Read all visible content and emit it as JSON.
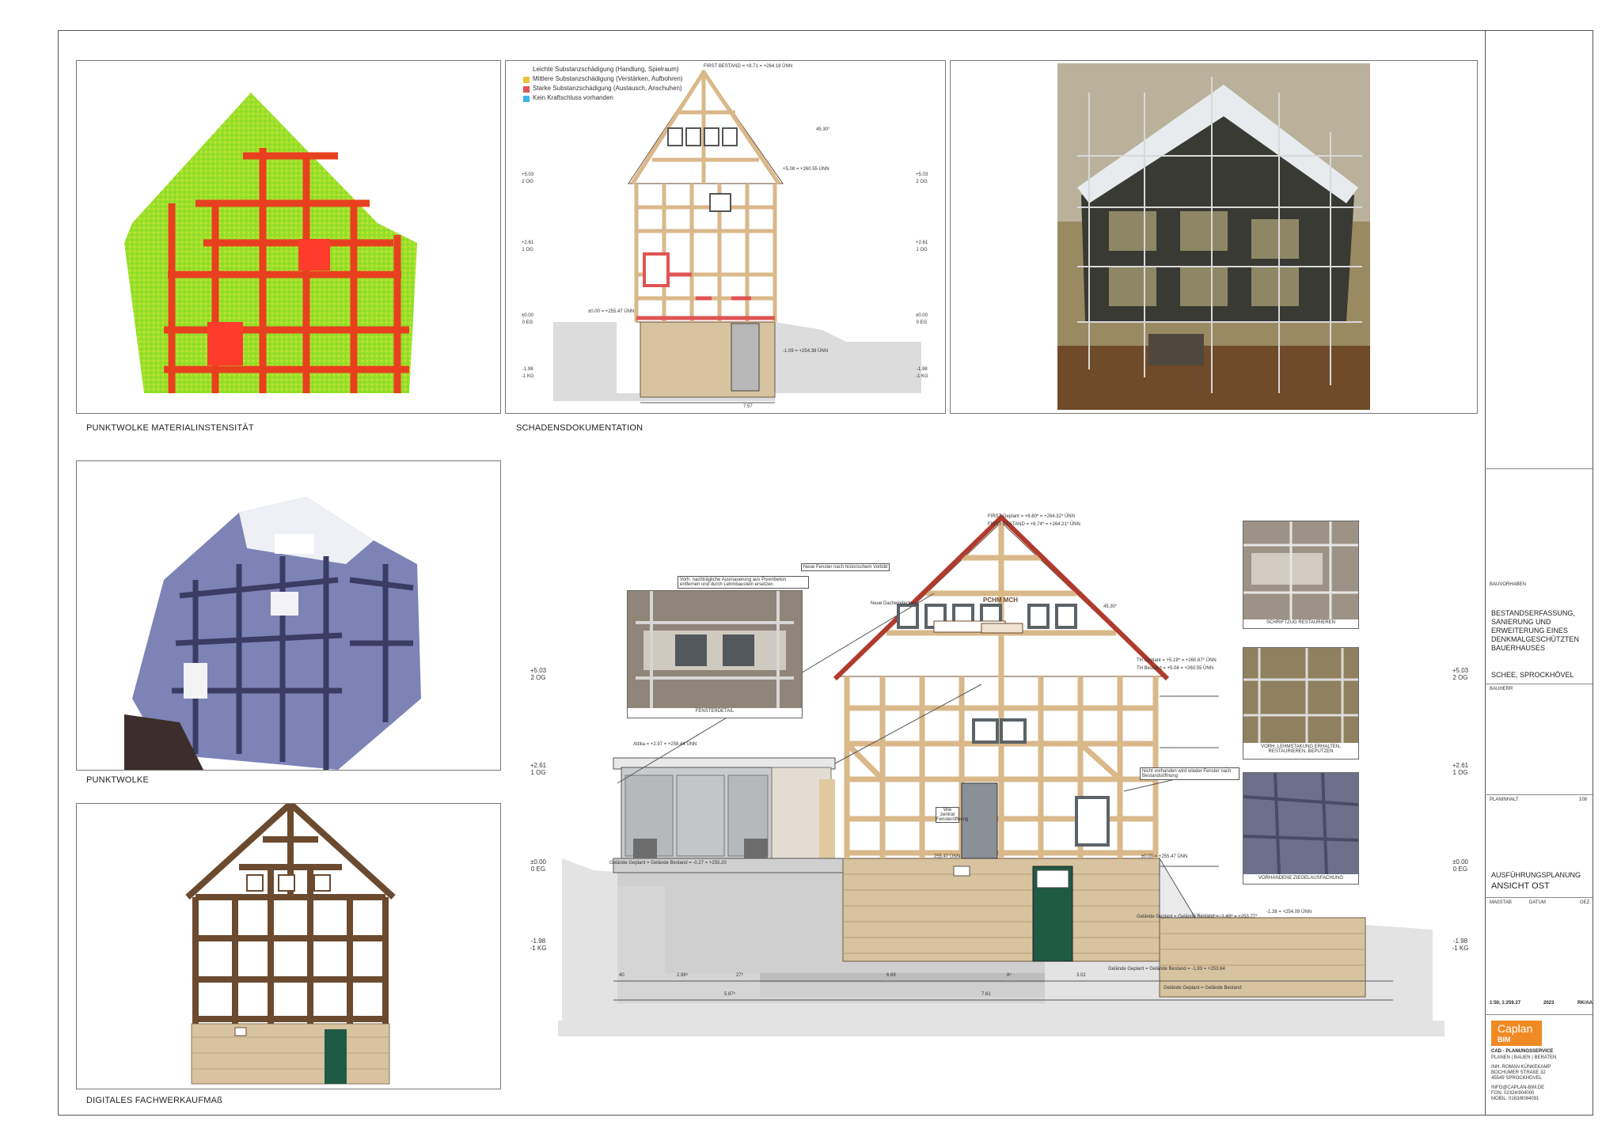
{
  "captions": {
    "pointcloud_intensity": "PUNKTWOLKE MATERIALINSTENSITÄT",
    "damage_documentation": "SCHADENSDOKUMENTATION",
    "pointcloud": "PUNKTWOLKE",
    "digital_survey": "DIGITALES FACHWERKAUFMAß"
  },
  "legend": {
    "items": [
      {
        "label": "Leichte Substanzschädigung (Handlung, Spielraum)",
        "color": "#ffffff"
      },
      {
        "label": "Mittlere Substanzschädigung (Verstärken, Aufbohren)",
        "color": "#e8c23a"
      },
      {
        "label": "Starke Substanzschädigung (Austausch, Anschuhen)",
        "color": "#e05454"
      },
      {
        "label": "Kein Kraftschluss vorhanden",
        "color": "#3fb6e6"
      }
    ]
  },
  "damage_drawing": {
    "first": "FIRST BESTAND = +8.71 = +264.18 ÜNN",
    "angle": "45.30°",
    "eaves": "+5.08 = +260.55 ÜNN",
    "base": "±0.00 = +255.47 ÜNN",
    "kg": "-1.09 = +254.38 ÜNN",
    "width": "7.57",
    "levels": [
      {
        "value": "+5.03",
        "name": "2 OG"
      },
      {
        "value": "+2.61",
        "name": "1 OG"
      },
      {
        "value": "±0.00",
        "name": "0 EG"
      },
      {
        "value": "-1.98",
        "name": "-1 KG"
      }
    ]
  },
  "main_drawing": {
    "first_planned": "FIRST Geplant = +8.80* = +264.32* ÜNN",
    "first_existing": "FIRST BESTAND = +8.74* = +264.21* ÜNN",
    "angle": "45.30°",
    "eaves_planned": "TH Geplant = +5.19* = +260.67* ÜNN",
    "eaves_existing": "TH Bestand = +5.08 = +260.55 ÜNN",
    "attika": "Attika = +2.97 = +258.44 ÜNN",
    "base_label": "±0.00 = +255.47 ÜNN",
    "base_left": "255.47 ÜNN",
    "terrain_right": "Gelände Geplant = Gelände Bestand = -1.49* = +253.77*",
    "terrain_left": "Gelände Geplant = Gelände Bestand = -0.27 = +255.20",
    "right_level": "-1.38 = +254.09 ÜNN",
    "bottom_terrain": "Gelände Geplant = Gelände Bestand = -1.83 = +253.64",
    "bottom_label": "Gelände Geplant = Gelände Bestand",
    "inscription": "PCHM MCH",
    "door_note": "Wie zentral Fensteröffnung",
    "dims_top": [
      "40",
      "2.98⁵",
      "27⁵",
      "6.69",
      "8⁵",
      "3.02"
    ],
    "dims_bottom": [
      "5.87⁵",
      "7.61"
    ],
    "annotations": [
      "Neue Fenster nach historischem Vorbild",
      "Vorh. nachträgliche Ausmauerung aus Porenbeton entfernen und durch Lehmbaustein ersetzen",
      "Neue Dacheindeckung",
      "Nicht vorhanden wird wieder Fenster nach Bestandsöffnung"
    ],
    "levels_left": [
      {
        "value": "+5.03",
        "name": "2 OG"
      },
      {
        "value": "+2.61",
        "name": "1 OG"
      },
      {
        "value": "±0.00",
        "name": "0 EG"
      },
      {
        "value": "-1.98",
        "name": "-1 KG"
      }
    ],
    "levels_right": [
      {
        "value": "+5.03",
        "name": "2 OG"
      },
      {
        "value": "+2.61",
        "name": "1 OG"
      },
      {
        "value": "±0.00",
        "name": "0 EG"
      },
      {
        "value": "-1.98",
        "name": "-1 KG"
      }
    ]
  },
  "detail_photos": {
    "window": "FENSTERDETAIL",
    "inscription": "SCHRIFTZUG RESTAURIEREN",
    "clay": "VORH. LEHMSTAKUNG ERHALTEN, RESTAURIEREN, BEPUTZEN",
    "tiles": "VORHANDENE ZIEGELAUSFACHUNG"
  },
  "title_block": {
    "project_label": "BAUVORHABEN",
    "project": "BESTANDSERFASSUNG, SANIERUNG UND ERWEITERUNG EINES DENKMALGESCHÜTZTEN BAUERHAUSES",
    "location": "SCHEE, SPROCKHÖVEL",
    "client_label": "BAUHERR",
    "content_label": "PLANINHALT",
    "plan_number": "108",
    "phase": "AUSFÜHRUNGSPLANUNG",
    "view": "ANSICHT OST",
    "col_scale": "MAßSTAB",
    "col_date": "DATUM",
    "col_drawn": "GEZ.",
    "scale": "1:50, 1:259.27",
    "year": "2023",
    "drawn": "RK/AA",
    "logo_text": "Caplan",
    "logo_sub": "BIM",
    "company": "CAD - PLANUNGSSERVICE",
    "tagline": "PLANEN | BAUEN | BERATEN",
    "owner": "INH. ROMAN KÜNKEKAMP",
    "street": "BOCHUMER STRAßE 32",
    "city": "45549 SPROCKHÖVEL",
    "email": "INFO@CAPLAN-BIM.DE",
    "phone": "FON: 02324/904000",
    "mobile": "MOBIL: 0163/8084091"
  },
  "colors": {
    "timber": "#d9b88a",
    "timber_dark": "#6b4a2f",
    "stone": "#d8c3a0",
    "roof_red": "#b03a2e",
    "damage_red": "#e05454",
    "ground": "#e0e0e0",
    "door_green": "#1f5a44",
    "window_grey": "#7a8288"
  }
}
